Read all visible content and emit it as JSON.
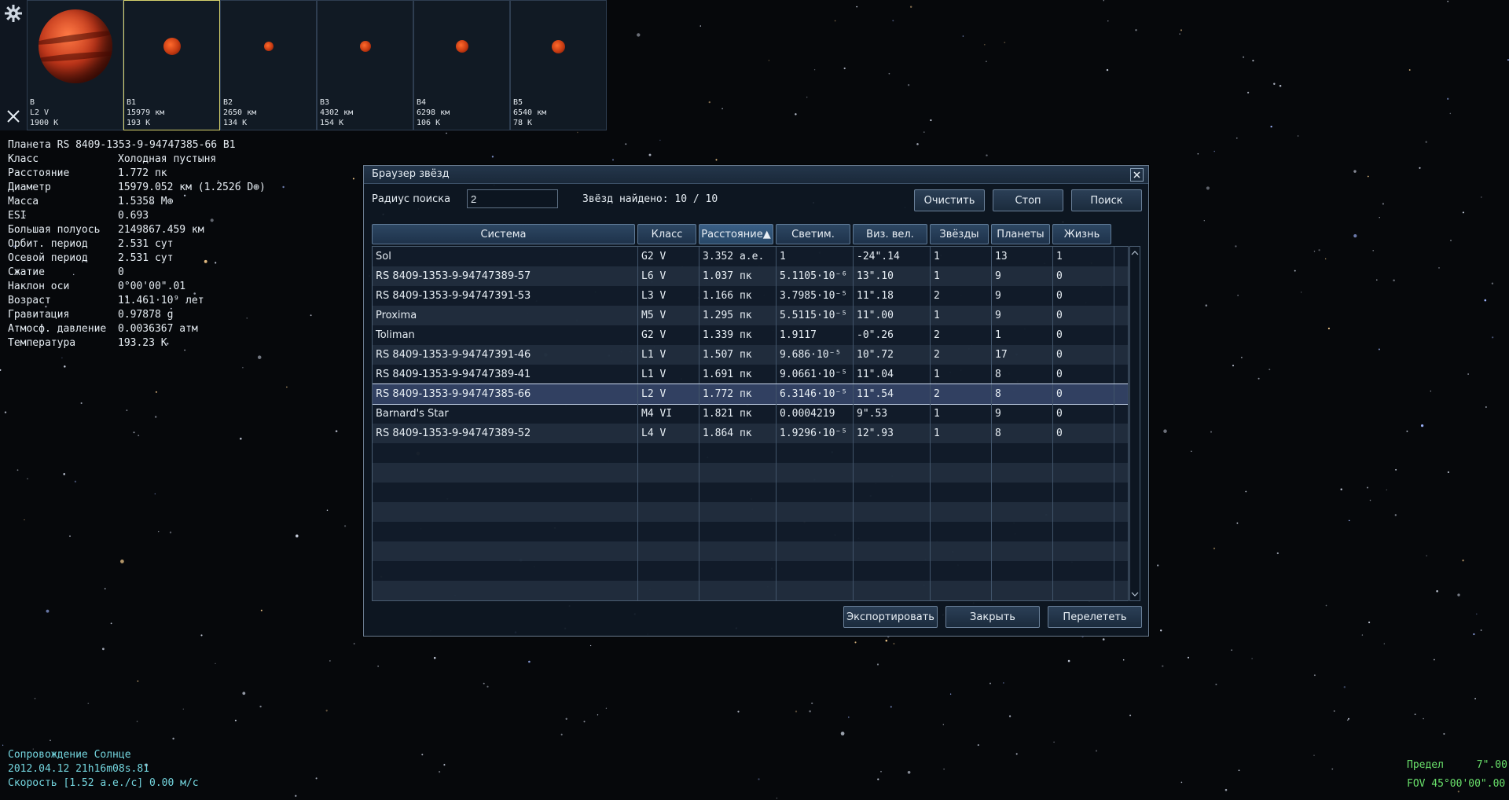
{
  "thumbnails": [
    {
      "lines": [
        "B",
        "L2 V",
        "1900 K"
      ]
    },
    {
      "lines": [
        "B1",
        "15979 км",
        "193 K"
      ]
    },
    {
      "lines": [
        "B2",
        "2650 км",
        "134 K"
      ]
    },
    {
      "lines": [
        "B3",
        "4302 км",
        "154 K"
      ]
    },
    {
      "lines": [
        "B4",
        "6298 км",
        "106 K"
      ]
    },
    {
      "lines": [
        "B5",
        "6540 км",
        "78 K"
      ]
    }
  ],
  "info": {
    "title": "Планета  RS 8409-1353-9-94747385-66 B1",
    "rows": [
      {
        "k": "Класс",
        "v": "Холодная пустыня"
      },
      {
        "k": "Расстояние",
        "v": "1.772 пк"
      },
      {
        "k": "Диаметр",
        "v": "15979.052 км (1.2526 D⊕)"
      },
      {
        "k": "Масса",
        "v": "1.5358 M⊕"
      },
      {
        "k": "ESI",
        "v": "0.693"
      },
      {
        "k": "Большая полуось",
        "v": "2149867.459 км"
      },
      {
        "k": "Орбит. период",
        "v": "2.531 сут"
      },
      {
        "k": "Осевой период",
        "v": "2.531 сут"
      },
      {
        "k": "Сжатие",
        "v": "0"
      },
      {
        "k": "Наклон оси",
        "v": "0°00'00\".01"
      },
      {
        "k": "Возраст",
        "v": "11.461·10⁹ лет"
      },
      {
        "k": "Гравитация",
        "v": "0.97878 g"
      },
      {
        "k": "Атмосф. давление",
        "v": "0.0036367 атм"
      },
      {
        "k": "Температура",
        "v": "193.23 K"
      }
    ]
  },
  "dialog": {
    "title": "Браузер звёзд",
    "radius_label": "Радиус поиска",
    "radius_value": "2",
    "found_text": "Звёзд найдено: 10 / 10",
    "buttons": {
      "clear": "Очистить",
      "stop": "Стоп",
      "search": "Поиск",
      "export": "Экспортировать",
      "close": "Закрыть",
      "fly": "Перелететь"
    },
    "columns": [
      "Система",
      "Класс",
      "Расстояние▲",
      "Светим.",
      "Виз. вел.",
      "Звёзды",
      "Планеты",
      "Жизнь"
    ],
    "rows": [
      [
        "Sol",
        "G2 V",
        "3.352 a.e.",
        "1",
        "-24\".14",
        "1",
        "13",
        "1"
      ],
      [
        "RS 8409-1353-9-94747389-57",
        "L6 V",
        "1.037 пк",
        "5.1105·10⁻⁶",
        "13\".10",
        "1",
        "9",
        "0"
      ],
      [
        "RS 8409-1353-9-94747391-53",
        "L3 V",
        "1.166 пк",
        "3.7985·10⁻⁵",
        "11\".18",
        "2",
        "9",
        "0"
      ],
      [
        "Proxima",
        "M5 V",
        "1.295 пк",
        "5.5115·10⁻⁵",
        "11\".00",
        "1",
        "9",
        "0"
      ],
      [
        "Toliman",
        "G2 V",
        "1.339 пк",
        "1.9117",
        "-0\".26",
        "2",
        "1",
        "0"
      ],
      [
        "RS 8409-1353-9-94747391-46",
        "L1 V",
        "1.507 пк",
        "9.686·10⁻⁵",
        "10\".72",
        "2",
        "17",
        "0"
      ],
      [
        "RS 8409-1353-9-94747389-41",
        "L1 V",
        "1.691 пк",
        "9.0661·10⁻⁵",
        "11\".04",
        "1",
        "8",
        "0"
      ],
      [
        "RS 8409-1353-9-94747385-66",
        "L2 V",
        "1.772 пк",
        "6.3146·10⁻⁵",
        "11\".54",
        "2",
        "8",
        "0"
      ],
      [
        "Barnard's Star",
        "M4 VI",
        "1.821 пк",
        "0.0004219",
        "9\".53",
        "1",
        "9",
        "0"
      ],
      [
        "RS 8409-1353-9-94747389-52",
        "L4 V",
        "1.864 пк",
        "1.9296·10⁻⁵",
        "12\".93",
        "1",
        "8",
        "0"
      ]
    ],
    "selected_row": 7
  },
  "hud": {
    "follow": "Сопровождение Солнце",
    "datetime": "2012.04.12  21h16m08s.81",
    "speed": "Скорость [1.52 a.e./c] 0.00 м/с",
    "limit_label": "Предел",
    "limit_value": "7\".00",
    "fov": "FOV 45°00'00\".00"
  }
}
